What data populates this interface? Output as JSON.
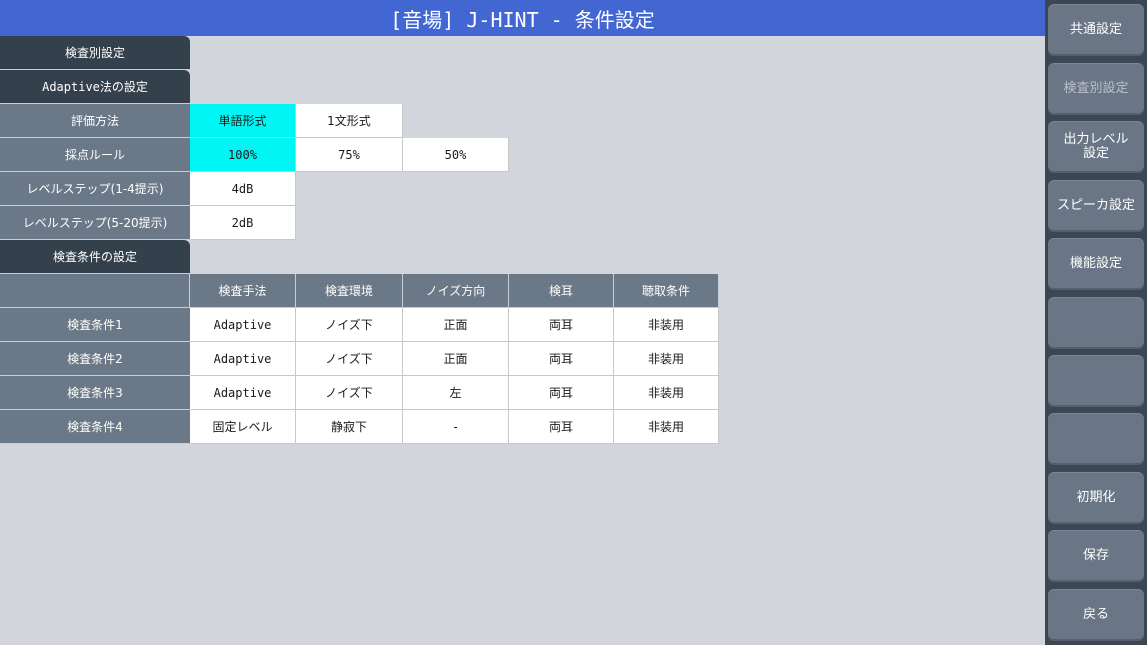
{
  "title": "[音場] J-HINT - 条件設定",
  "sidebar": {
    "common": "共通設定",
    "per_test": "検査別設定",
    "output_level": "出力レベル\n設定",
    "speaker": "スピーカ設定",
    "function": "機能設定",
    "init": "初期化",
    "save": "保存",
    "back": "戻る"
  },
  "sections": {
    "per_test": "検査別設定",
    "adaptive": "Adaptive法の設定",
    "conditions": "検査条件の設定"
  },
  "settings": {
    "eval_method": {
      "label": "評価方法",
      "options": [
        "単語形式",
        "1文形式"
      ],
      "selected": "単語形式"
    },
    "scoring_rule": {
      "label": "採点ルール",
      "options": [
        "100%",
        "75%",
        "50%"
      ],
      "selected": "100%"
    },
    "level_step_1_4": {
      "label": "レベルステップ(1-4提示)",
      "value": "4dB"
    },
    "level_step_5_20": {
      "label": "レベルステップ(5-20提示)",
      "value": "2dB"
    }
  },
  "conditions_table": {
    "headers": [
      "検査手法",
      "検査環境",
      "ノイズ方向",
      "検耳",
      "聴取条件"
    ],
    "rows": [
      {
        "label": "検査条件1",
        "cells": [
          "Adaptive",
          "ノイズ下",
          "正面",
          "両耳",
          "非装用"
        ]
      },
      {
        "label": "検査条件2",
        "cells": [
          "Adaptive",
          "ノイズ下",
          "正面",
          "両耳",
          "非装用"
        ]
      },
      {
        "label": "検査条件3",
        "cells": [
          "Adaptive",
          "ノイズ下",
          "左",
          "両耳",
          "非装用"
        ]
      },
      {
        "label": "検査条件4",
        "cells": [
          "固定レベル",
          "静寂下",
          "-",
          "両耳",
          "非装用"
        ]
      }
    ]
  }
}
